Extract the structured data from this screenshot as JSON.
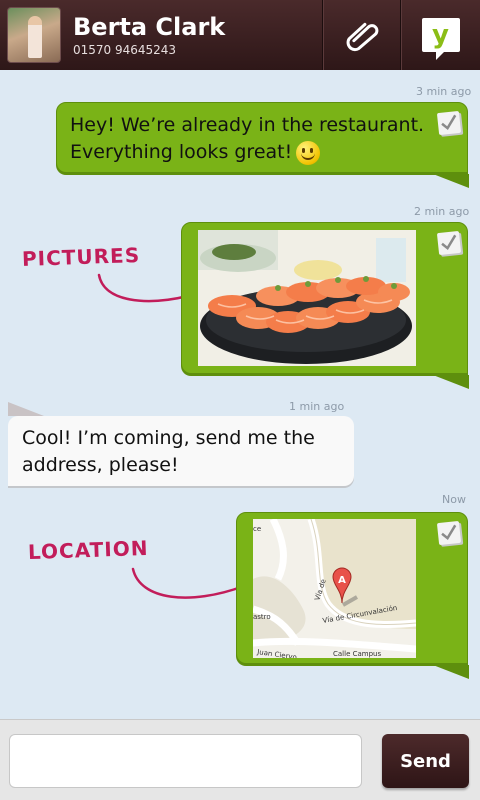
{
  "header": {
    "contact_name": "Berta Clark",
    "contact_phone": "01570 94645243",
    "attach_icon": "paperclip-icon",
    "app_icon": "yappy-logo-icon",
    "app_logo_letter": "y"
  },
  "messages": [
    {
      "direction": "outgoing",
      "timestamp": "3 min ago",
      "text_line1": "Hey! We’re already in the restaurant.",
      "text_line2": "Everything looks great!",
      "emoji": "smiley-icon"
    },
    {
      "direction": "outgoing",
      "timestamp": "2 min ago",
      "type": "picture"
    },
    {
      "direction": "incoming",
      "timestamp": "1 min ago",
      "text_line1": "Cool! I’m coming, send me the",
      "text_line2": "address, please!"
    },
    {
      "direction": "outgoing",
      "timestamp": "Now",
      "type": "location"
    }
  ],
  "annotations": {
    "pictures": "PICTURES",
    "location": "LOCATION"
  },
  "map_labels": {
    "marker": "A",
    "street1": "Vía de Circunvalación",
    "street2": "Calle Campus",
    "street3": "Vía de",
    "street4": "Juan Ciervo",
    "street5": "astro",
    "street6": "ce"
  },
  "composer": {
    "input_value": "",
    "input_placeholder": "",
    "send_label": "Send"
  },
  "colors": {
    "header_bg": "#3b1f20",
    "outgoing_bubble": "#7ab317",
    "incoming_bubble": "#f9f9f9",
    "chat_bg": "#dde9f3",
    "annotation": "#c21d5a"
  }
}
